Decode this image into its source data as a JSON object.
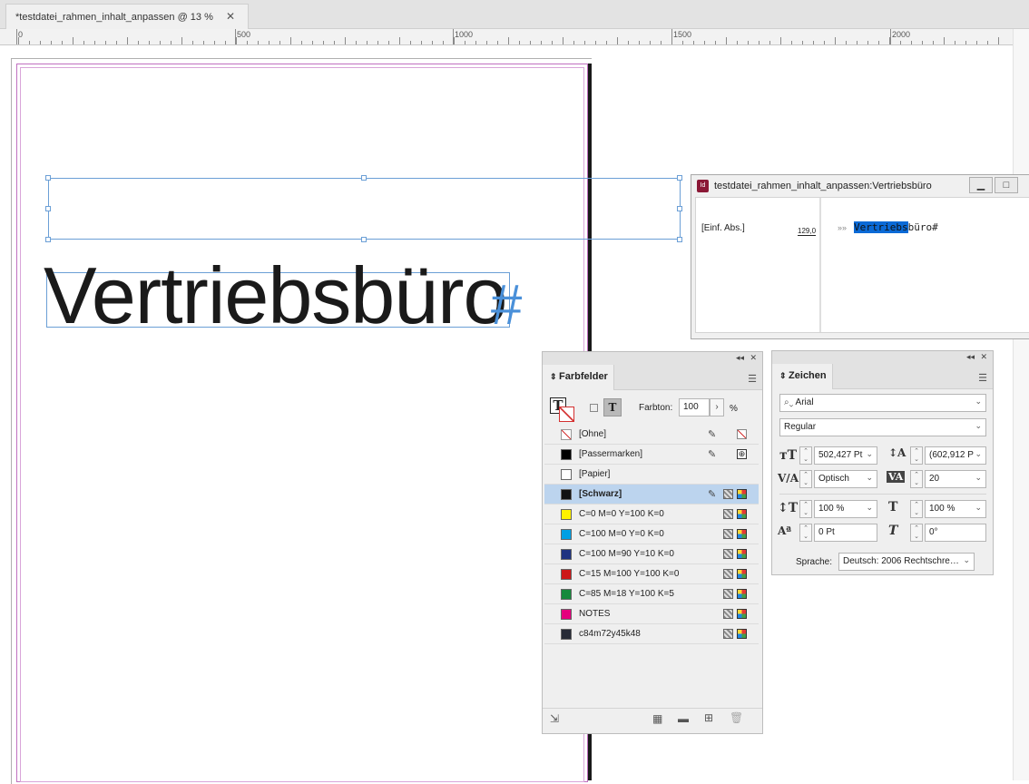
{
  "document_tab": {
    "title": "*testdatei_rahmen_inhalt_anpassen @ 13 %",
    "close": "✕"
  },
  "ruler": {
    "labels": [
      "0",
      "500",
      "1000",
      "1500",
      "2000"
    ]
  },
  "canvas": {
    "text": "Vertriebsbüro",
    "end_marker": "#"
  },
  "story_editor": {
    "title": "testdatei_rahmen_inhalt_anpassen:Vertriebsbüro",
    "paragraph_style": "[Einf. Abs.]",
    "depth": "129,0",
    "marker": "»»",
    "text_selected": "Vertriebs",
    "text_rest": "büro#",
    "btn_minimize": "▁",
    "btn_maximize": "□"
  },
  "swatches_panel": {
    "tab": "Farbfelder",
    "tint_label": "Farbton:",
    "tint_value": "100",
    "tint_unit": "%",
    "items": [
      {
        "name": "[Ohne]",
        "color": "none",
        "bold": false,
        "selected": false
      },
      {
        "name": "[Passermarken]",
        "color": "#000000",
        "bold": false,
        "selected": false
      },
      {
        "name": "[Papier]",
        "color": "#ffffff",
        "bold": false,
        "selected": false
      },
      {
        "name": "[Schwarz]",
        "color": "#111111",
        "bold": true,
        "selected": true
      },
      {
        "name": "C=0 M=0 Y=100 K=0",
        "color": "#fff200",
        "bold": false,
        "selected": false
      },
      {
        "name": "C=100 M=0 Y=0 K=0",
        "color": "#009fe3",
        "bold": false,
        "selected": false
      },
      {
        "name": "C=100 M=90 Y=10 K=0",
        "color": "#1f3381",
        "bold": false,
        "selected": false
      },
      {
        "name": "C=15 M=100 Y=100 K=0",
        "color": "#cc1719",
        "bold": false,
        "selected": false
      },
      {
        "name": "C=85 M=18 Y=100 K=5",
        "color": "#168a3c",
        "bold": false,
        "selected": false
      },
      {
        "name": "NOTES",
        "color": "#e5007d",
        "bold": false,
        "selected": false
      },
      {
        "name": "c84m72y45k48",
        "color": "#262a36",
        "bold": false,
        "selected": false
      }
    ]
  },
  "character_panel": {
    "tab": "Zeichen",
    "font_family": "Arial",
    "font_style": "Regular",
    "font_size": "502,427 Pt",
    "leading": "(602,912 P",
    "kerning": "Optisch",
    "tracking": "20",
    "vertical_scale": "100 %",
    "horizontal_scale": "100 %",
    "baseline_shift": "0 Pt",
    "skew": "0°",
    "language_label": "Sprache:",
    "language": "Deutsch: 2006 Rechtschre…"
  }
}
